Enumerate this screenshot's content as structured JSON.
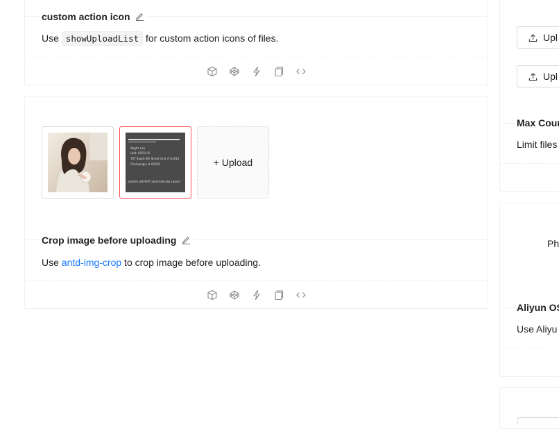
{
  "demo_custom_icon": {
    "title": "custom action icon",
    "desc_prefix": "Use ",
    "desc_code": "showUploadList",
    "desc_suffix": " for custom action icons of files."
  },
  "demo_crop": {
    "upload_label": "+ Upload",
    "thumb2_lines": [
      "Ahgha Lau",
      "Unit: A1014-B",
      "707 South 6th Street Unit # A1014",
      "Champaign, IL 61820",
      "...system will NOT automatically cancel"
    ],
    "title": "Crop image before uploading",
    "desc_prefix": "Use ",
    "desc_link": "antd-img-crop",
    "desc_suffix": " to crop image before uploading."
  },
  "right_column": {
    "button1": "Upl",
    "button2": "Upl",
    "max_count_title": "Max Coun",
    "max_count_desc": "Limit files",
    "photo_text": "Ph",
    "aliyun_title": "Aliyun OS",
    "aliyun_desc": "Use Aliyu"
  },
  "colors": {
    "link": "#1677ff",
    "error_border": "#ff4d4f",
    "border": "#f0f0f0"
  }
}
